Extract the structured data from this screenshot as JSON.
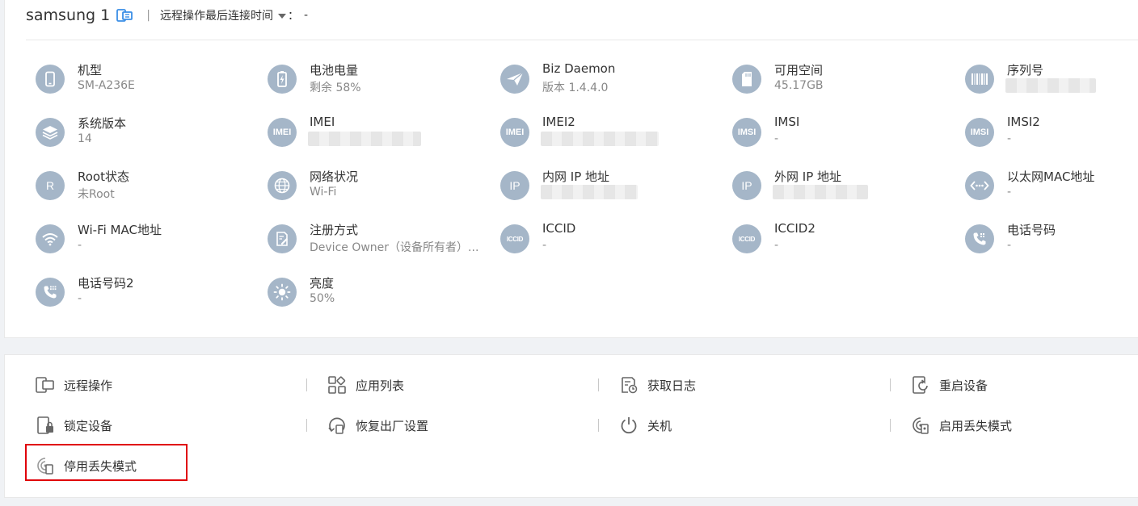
{
  "header": {
    "device_name": "samsung 1",
    "separator": "|",
    "last_connect_label": "远程操作最后连接时间",
    "colon": "：",
    "last_connect_value": "-"
  },
  "info": [
    {
      "label": "机型",
      "value": "SM-A236E",
      "icon": "phone-icon"
    },
    {
      "label": "电池电量",
      "value": "剩余 58%",
      "icon": "battery-icon"
    },
    {
      "label": "Biz Daemon",
      "value": "版本 1.4.4.0",
      "icon": "paper-plane-icon"
    },
    {
      "label": "可用空间",
      "value": "45.17GB",
      "icon": "sd-card-icon"
    },
    {
      "label": "序列号",
      "value": "",
      "icon": "barcode-icon"
    },
    {
      "label": "系统版本",
      "value": "14",
      "icon": "layers-icon"
    },
    {
      "label": "IMEI",
      "value": "",
      "icon": "imei-icon",
      "icon_text": "IMEI"
    },
    {
      "label": "IMEI2",
      "value": "",
      "icon": "imei-icon",
      "icon_text": "IMEI"
    },
    {
      "label": "IMSI",
      "value": "-",
      "icon": "imsi-icon",
      "icon_text": "IMSI"
    },
    {
      "label": "IMSI2",
      "value": "-",
      "icon": "imsi-icon",
      "icon_text": "IMSI"
    },
    {
      "label": "Root状态",
      "value": "未Root",
      "icon": "root-icon",
      "icon_text": "R"
    },
    {
      "label": "网络状况",
      "value": "Wi-Fi",
      "icon": "globe-icon"
    },
    {
      "label": "内网 IP 地址",
      "value": "",
      "icon": "ip-icon",
      "icon_text": "IP"
    },
    {
      "label": "外网 IP 地址",
      "value": "",
      "icon": "ip-icon",
      "icon_text": "IP"
    },
    {
      "label": "以太网MAC地址",
      "value": "-",
      "icon": "ethernet-icon"
    },
    {
      "label": "Wi-Fi MAC地址",
      "value": "-",
      "icon": "wifi-icon"
    },
    {
      "label": "注册方式",
      "value": "Device Owner（设备所有者）...",
      "icon": "register-form-icon"
    },
    {
      "label": "ICCID",
      "value": "-",
      "icon": "iccid-icon",
      "icon_text": "ICCID"
    },
    {
      "label": "ICCID2",
      "value": "-",
      "icon": "iccid-icon",
      "icon_text": "ICCID"
    },
    {
      "label": "电话号码",
      "value": "-",
      "icon": "phone-call-icon"
    },
    {
      "label": "电话号码2",
      "value": "-",
      "icon": "phone-keypad-icon"
    },
    {
      "label": "亮度",
      "value": "50%",
      "icon": "brightness-icon"
    }
  ],
  "actions": [
    {
      "label": "远程操作",
      "icon": "remote-control-icon"
    },
    {
      "label": "应用列表",
      "icon": "app-list-icon"
    },
    {
      "label": "获取日志",
      "icon": "log-icon"
    },
    {
      "label": "重启设备",
      "icon": "restart-icon"
    },
    {
      "label": "锁定设备",
      "icon": "lock-device-icon"
    },
    {
      "label": "恢复出厂设置",
      "icon": "factory-reset-icon"
    },
    {
      "label": "关机",
      "icon": "power-icon"
    },
    {
      "label": "启用丢失模式",
      "icon": "lost-mode-on-icon"
    },
    {
      "label": "停用丢失模式",
      "icon": "lost-mode-off-icon"
    }
  ],
  "colors": {
    "icon_circle": "#a5b6c8",
    "highlight": "#e0000a",
    "text": "#333333",
    "muted": "#888888"
  }
}
